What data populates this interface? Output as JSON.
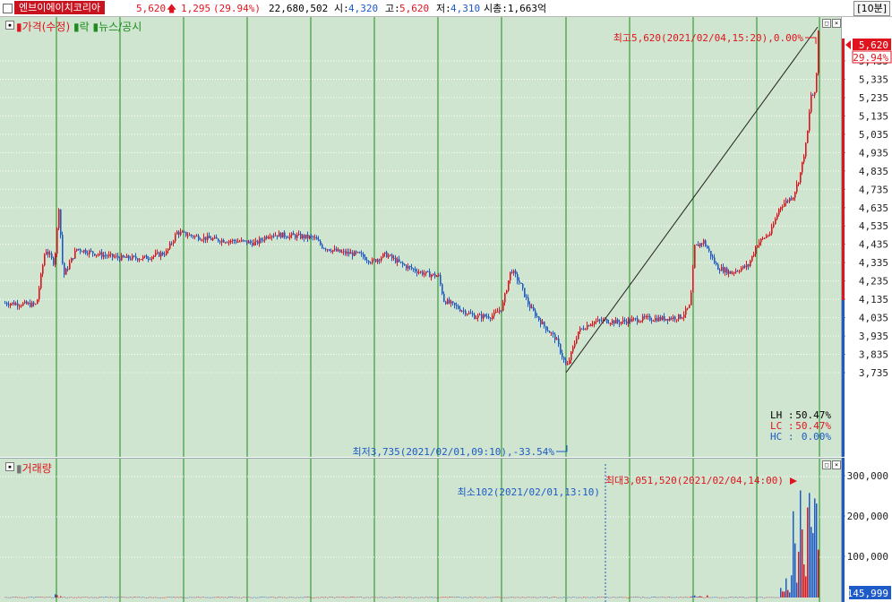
{
  "header": {
    "stock_name": "엔브이에이치코리아",
    "price": "5,620",
    "change": "1,295",
    "change_pct": "(29.94%)",
    "volume": "22,680,502",
    "open_label": "시:",
    "open": "4,320",
    "high_label": "고:",
    "high": "5,620",
    "low_label": "저:",
    "low": "4,310",
    "mcap": "시총:1,663억",
    "interval": "[10분]"
  },
  "price_pane": {
    "legend": [
      "가격(수정)",
      "락",
      "뉴스/공시"
    ],
    "max_label": "최고5,620(2021/02/04,15:20),0.00%",
    "min_label": "최저3,735(2021/02/01,09:10),-33.54%",
    "stats": [
      {
        "label": "LH :",
        "value": "50.47%"
      },
      {
        "label": "LC :",
        "value": "50.47%"
      },
      {
        "label": "HC :",
        "value": "0.00%"
      }
    ],
    "axis_ticks": [
      "5,435",
      "5,335",
      "5,235",
      "5,135",
      "5,035",
      "4,935",
      "4,835",
      "4,735",
      "4,635",
      "4,535",
      "4,435",
      "4,335",
      "4,235",
      "4,135",
      "4,035",
      "3,935",
      "3,835",
      "3,735"
    ],
    "current_price_badge": "5,620",
    "current_pct_badge": "29.94%"
  },
  "volume_pane": {
    "legend": "거래량",
    "min_label": "최소102(2021/02/01,13:10)",
    "max_label": "최대3,051,520(2021/02/04,14:00)",
    "axis_ticks": [
      "300,000",
      "200,000",
      "100,000"
    ],
    "current_badge": "145,999"
  },
  "colors": {
    "up": "#e0141e",
    "down": "#1e5ac8",
    "grid": "#1e8c1e",
    "bg": "#cfe5cf"
  },
  "chart_data": {
    "type": "candlestick",
    "price_ylim": [
      3735,
      5620
    ],
    "volume_ylim": [
      0,
      300000
    ]
  }
}
